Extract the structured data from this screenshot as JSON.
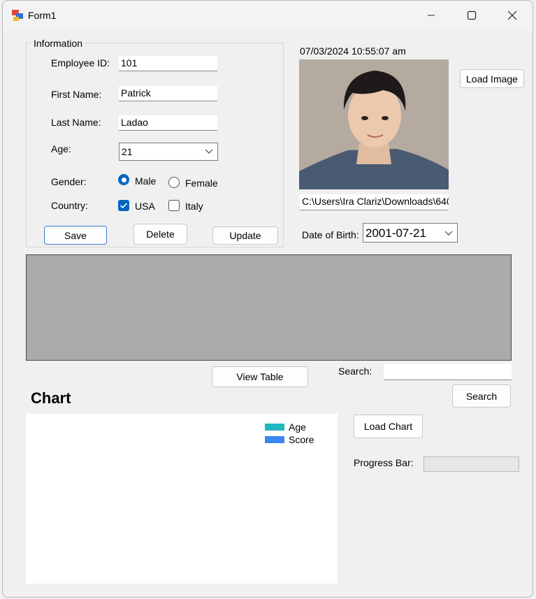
{
  "window": {
    "title": "Form1"
  },
  "info_group": {
    "caption": "Information",
    "employee_id": {
      "label": "Employee ID:",
      "value": "101"
    },
    "first_name": {
      "label": "First Name:",
      "value": "Patrick"
    },
    "last_name": {
      "label": "Last Name:",
      "value": "Ladao"
    },
    "age": {
      "label": "Age:",
      "value": "21"
    },
    "gender": {
      "label": "Gender:",
      "options": [
        "Male",
        "Female"
      ],
      "selected": "Male"
    },
    "country": {
      "label": "Country:",
      "options": [
        "USA",
        "Italy"
      ],
      "checked": [
        "USA"
      ]
    },
    "buttons": {
      "save": "Save",
      "delete": "Delete",
      "update": "Update"
    }
  },
  "datetime_display": "07/03/2024 10:55:07 am",
  "image_path": "C:\\Users\\Ira Clariz\\Downloads\\640",
  "load_image_label": "Load Image",
  "dob": {
    "label": "Date of Birth:",
    "value": "2001-07-21"
  },
  "view_table_label": "View Table",
  "search": {
    "label": "Search:",
    "value": "",
    "button": "Search"
  },
  "chart_heading": "Chart",
  "load_chart_label": "Load Chart",
  "progress": {
    "label": "Progress Bar:",
    "value": 0
  },
  "colors": {
    "accent": "#0067c0",
    "age_series": "#1fb6c1",
    "score_series": "#3b86f0",
    "grid_bg": "#ababab"
  },
  "chart_data": {
    "type": "bar",
    "categories": [],
    "series": [
      {
        "name": "Age",
        "values": []
      },
      {
        "name": "Score",
        "values": []
      }
    ],
    "legend": "top-right"
  }
}
